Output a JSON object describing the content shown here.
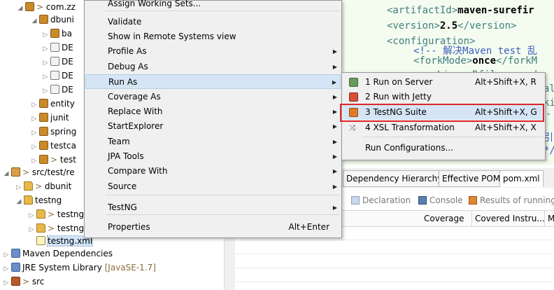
{
  "explorer": {
    "rows": [
      {
        "label": "com.zz",
        "prefix": "> "
      },
      {
        "label": "dbuni"
      },
      {
        "label": "ba"
      },
      {
        "label": "DE"
      },
      {
        "label": "DE"
      },
      {
        "label": "DE"
      },
      {
        "label": "DE"
      },
      {
        "label": "entity"
      },
      {
        "label": "junit"
      },
      {
        "label": "spring"
      },
      {
        "label": "testca"
      },
      {
        "label": "test",
        "prefix": "> "
      },
      {
        "label": "src/test/re",
        "prefix": "> "
      },
      {
        "label": "dbunit",
        "prefix": "> "
      },
      {
        "label": "testng"
      },
      {
        "label": "testng",
        "prefix": "> "
      },
      {
        "label": "testng",
        "prefix": "> "
      },
      {
        "label": "testng.xml"
      },
      {
        "label": "Maven Dependencies"
      },
      {
        "label": "JRE System Library",
        "suffix": "[JavaSE-1.7]"
      },
      {
        "label": "src",
        "prefix": "> "
      }
    ]
  },
  "editor": {
    "lines": [
      {
        "open": "<artifactId>",
        "text": "maven-surefir",
        "close": ""
      },
      {
        "open": "<version>",
        "text": "2.5",
        "close": "</version>"
      },
      {
        "open": "<configuration>",
        "text": "",
        "close": ""
      },
      {
        "comment": "<!-- 解决Maven test 乱"
      },
      {
        "open": "<forkMode>",
        "text": "once",
        "close": "</forkM"
      },
      {
        "fragment": "<argLine> Dfile.encod"
      },
      {
        "fragment": "al"
      },
      {
        "fragment": "ki"
      },
      {
        "fragment": "-"
      },
      {
        "fragment": "引含"
      },
      {
        "fragment": "*/"
      }
    ]
  },
  "context_menu": {
    "items": [
      {
        "label": "Assign Working Sets...",
        "shortcut": "",
        "submenu": false
      },
      {
        "label": "Validate",
        "shortcut": "",
        "submenu": false
      },
      {
        "label": "Show in Remote Systems view",
        "shortcut": "",
        "submenu": false
      },
      {
        "label": "Profile As",
        "shortcut": "",
        "submenu": true
      },
      {
        "label": "Debug As",
        "shortcut": "",
        "submenu": true
      },
      {
        "label": "Run As",
        "shortcut": "",
        "submenu": true
      },
      {
        "label": "Coverage As",
        "shortcut": "",
        "submenu": true
      },
      {
        "label": "Replace With",
        "shortcut": "",
        "submenu": true
      },
      {
        "label": "StartExplorer",
        "shortcut": "",
        "submenu": true
      },
      {
        "label": "Team",
        "shortcut": "",
        "submenu": true
      },
      {
        "label": "JPA Tools",
        "shortcut": "",
        "submenu": true
      },
      {
        "label": "Compare With",
        "shortcut": "",
        "submenu": true
      },
      {
        "label": "Source",
        "shortcut": "",
        "submenu": true
      },
      {
        "label": "TestNG",
        "shortcut": "",
        "submenu": true
      },
      {
        "label": "Properties",
        "shortcut": "Alt+Enter",
        "submenu": false
      }
    ]
  },
  "run_as_submenu": {
    "items": [
      {
        "label": "1 Run on Server",
        "shortcut": "Alt+Shift+X, R",
        "icon": "server-icon"
      },
      {
        "label": "2 Run with Jetty",
        "shortcut": "",
        "icon": "jetty-icon"
      },
      {
        "label": "3 TestNG Suite",
        "shortcut": "Alt+Shift+X, G",
        "icon": "testng-icon"
      },
      {
        "label": "4 XSL Transformation",
        "shortcut": "Alt+Shift+X, X",
        "icon": "xsl-icon"
      },
      {
        "label": "Run Configurations...",
        "shortcut": ""
      }
    ]
  },
  "pom_tabs": [
    "Dependency Hierarchy",
    "Effective POM",
    "pom.xml"
  ],
  "view_tabs": [
    "Declaration",
    "Console",
    "Results of running"
  ],
  "columns": [
    "Coverage",
    "Covered Instru...",
    "M"
  ],
  "colors": {
    "highlight_box": "#e0262b",
    "menu_hover": "#d5e5f5"
  }
}
